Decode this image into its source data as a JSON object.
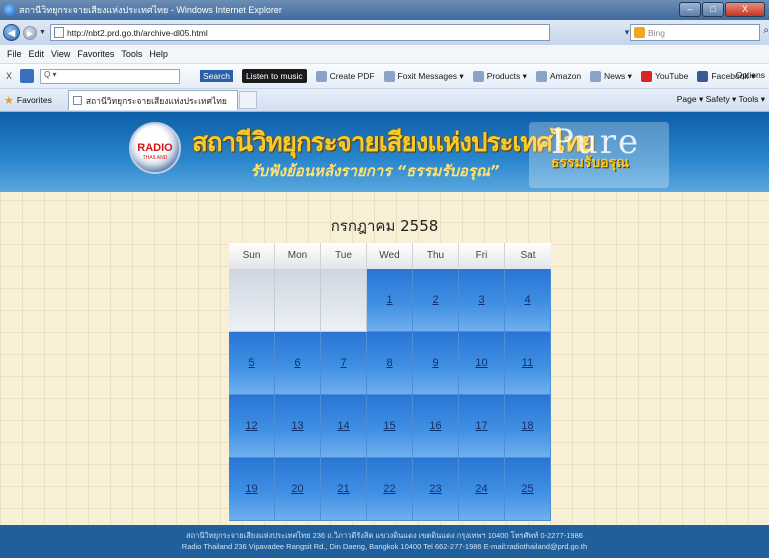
{
  "window": {
    "title": "สถานีวิทยุกระจายเสียงแห่งประเทศไทย - Windows Internet Explorer",
    "min_label": "–",
    "max_label": "□",
    "close_label": "X"
  },
  "address": {
    "url": "http://nbt2.prd.go.th/archive-dl05.html",
    "search_placeholder": "Bing"
  },
  "menu": [
    "File",
    "Edit",
    "View",
    "Favorites",
    "Tools",
    "Help"
  ],
  "toolbar": {
    "close": "X",
    "input_value": "Q ▾",
    "search": "Search",
    "items": [
      "Listen to music",
      "Create PDF",
      "Foxit Messages ▾",
      "Products ▾",
      "Amazon",
      "News ▾",
      "YouTube",
      "Facebook ▾"
    ],
    "options": "Options"
  },
  "favorites": {
    "label": "Favorites",
    "tab": "สถานีวิทยุกระจายเสียงแห่งประเทศไทย",
    "commands": "Page ▾  Safety ▾  Tools ▾"
  },
  "banner": {
    "logo_text": "RADIO",
    "logo_sub": "THAILAND",
    "station_name": "สถานีวิทยุกระจายเสียงแห่งประเทศไทย",
    "subtitle": "รับฟังย้อนหลังรายการ “ธรรมรับอรุณ”",
    "pure_word": "Pure",
    "pure_thai": "ธรรมรับอรุณ"
  },
  "calendar": {
    "month": "กรกฎาคม 2558",
    "days": [
      "Sun",
      "Mon",
      "Tue",
      "Wed",
      "Thu",
      "Fri",
      "Sat"
    ],
    "weeks": [
      [
        "",
        "",
        "",
        "1",
        "2",
        "3",
        "4"
      ],
      [
        "5",
        "6",
        "7",
        "8",
        "9",
        "10",
        "11"
      ],
      [
        "12",
        "13",
        "14",
        "15",
        "16",
        "17",
        "18"
      ],
      [
        "19",
        "20",
        "21",
        "22",
        "23",
        "24",
        "25"
      ]
    ]
  },
  "footer": {
    "line1": "สถานีวิทยุกระจายเสียงแห่งประเทศไทย 236 ถ.วิภาวดีรังสิต แขวงดินแดง เขตดินแดง กรุงเทพฯ 10400 โทรศัพท์ 0-2277-1986",
    "line2": "Radio Thailand 236 Vipavadee Rangsit Rd., Din Daeng, Bangkok 10400 Tel 662-277-1986 E-mail:radiothailand@prd.go.th"
  }
}
